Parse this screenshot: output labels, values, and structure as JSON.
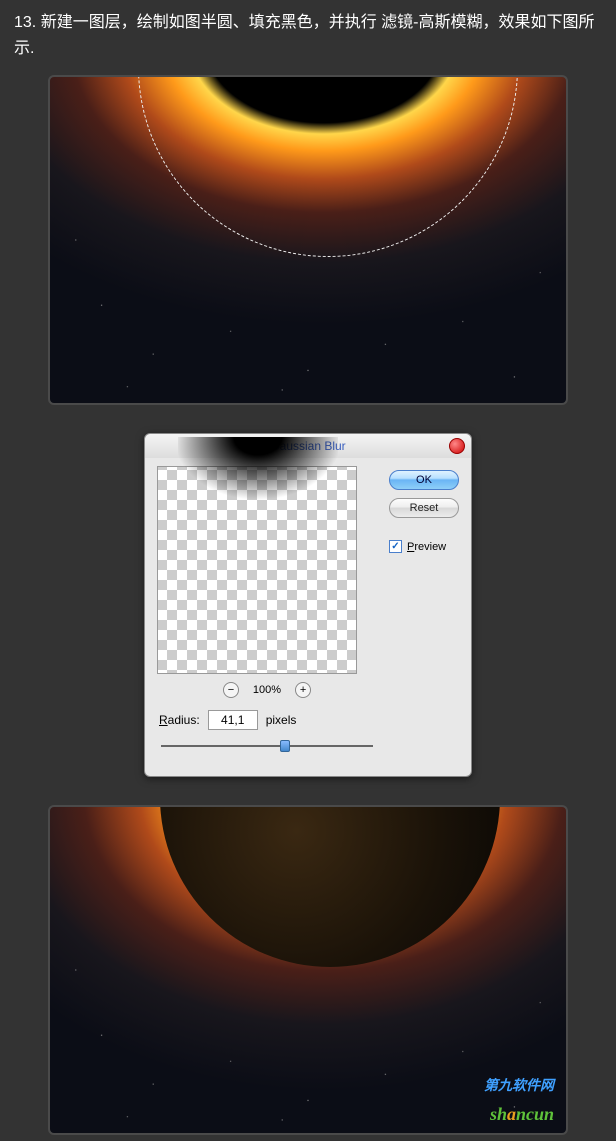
{
  "step_number": "13.",
  "instruction_text": "新建一图层，绘制如图半圆、填充黑色，并执行 滤镜-高斯模糊，效果如下图所示.",
  "dialog": {
    "title": "Gaussian Blur",
    "ok_label": "OK",
    "reset_label": "Reset",
    "preview_label": "Preview",
    "preview_checked": true,
    "zoom_percent": "100%",
    "radius_label_prefix": "R",
    "radius_label_rest": "adius:",
    "radius_value": "41,1",
    "radius_unit": "pixels",
    "minus": "−",
    "plus": "+",
    "check_glyph": "✓"
  },
  "watermark": {
    "line1": "第九软件网",
    "line2_a": "sh",
    "line2_b": "a",
    "line2_c": "ncun"
  }
}
